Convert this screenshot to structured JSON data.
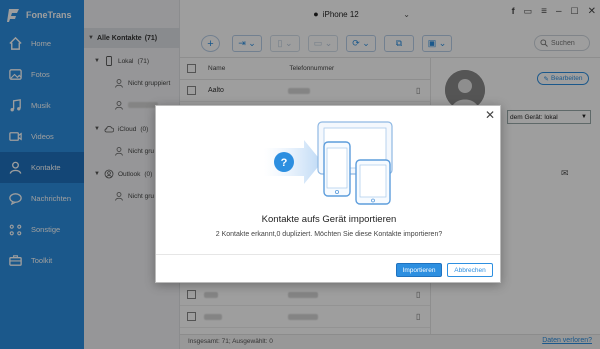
{
  "app": {
    "name": "FoneTrans"
  },
  "device": {
    "name": "iPhone 12"
  },
  "sidebar": {
    "items": [
      {
        "label": "Home"
      },
      {
        "label": "Fotos"
      },
      {
        "label": "Musik"
      },
      {
        "label": "Videos"
      },
      {
        "label": "Kontakte"
      },
      {
        "label": "Nachrichten"
      },
      {
        "label": "Sonstige"
      },
      {
        "label": "Toolkit"
      }
    ]
  },
  "tree": {
    "all": "Alle Kontakte",
    "all_count": "(71)",
    "groups": [
      {
        "label": "Lokal",
        "count": "(71)",
        "children": [
          "Nicht gruppiert"
        ]
      },
      {
        "label": "iCloud",
        "count": "(0)",
        "children": [
          "Nicht gru"
        ]
      },
      {
        "label": "Outlook",
        "count": "(0)",
        "children": [
          "Nicht gru"
        ]
      }
    ]
  },
  "search": {
    "placeholder": "Suchen"
  },
  "table": {
    "columns": [
      "Name",
      "Telefonnummer"
    ],
    "rows": [
      {
        "name": "Aalto"
      }
    ]
  },
  "detail": {
    "edit_label": "Bearbeiten",
    "store_value": "dem Gerät: lokal"
  },
  "status": {
    "count": "Insgesamt: 71; Ausgewählt: 0",
    "lost_link": "Daten verloren?"
  },
  "dialog": {
    "title": "Kontakte aufs Gerät importieren",
    "message": "2 Kontakte erkannt,0 dupliziert. Möchten Sie diese Kontakte importieren?",
    "confirm": "Importieren",
    "cancel": "Abbrechen"
  },
  "colors": {
    "accent": "#2d8fe0",
    "sidebar": "#2d8fe0",
    "sidebar_active": "#1f72bf"
  }
}
